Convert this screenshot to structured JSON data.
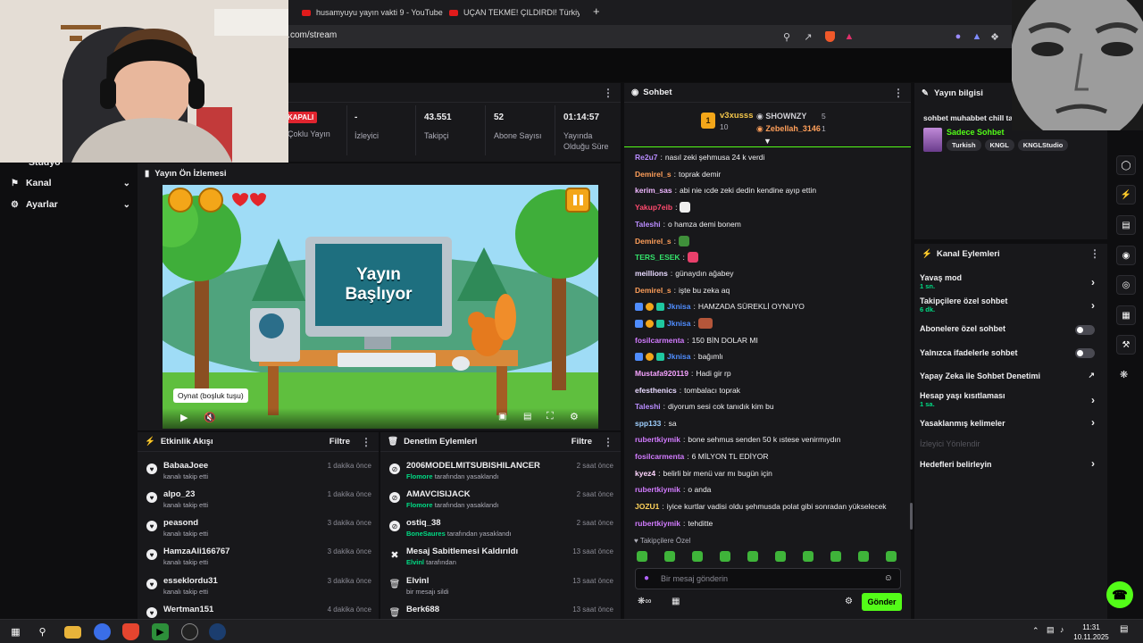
{
  "browser": {
    "tabs": [
      {
        "title": "husamyuyu yayın vakti 9 - YouTube"
      },
      {
        "title": "UÇAN TEKME! ÇILDIRDI! Türkiye'de "
      }
    ],
    "new_tab": "+",
    "url": "ick.com/stream"
  },
  "sidebar": {
    "items": [
      {
        "label": "Stüdyo"
      },
      {
        "label": "Kanal"
      },
      {
        "label": "Ayarlar"
      }
    ]
  },
  "stats": [
    {
      "value": "KAPALI",
      "label": "Çoklu Yayın"
    },
    {
      "value": "-",
      "label": "İzleyici"
    },
    {
      "value": "43.551",
      "label": "Takipçi"
    },
    {
      "value": "52",
      "label": "Abone Sayısı"
    },
    {
      "value": "01:14:57",
      "label": "Yayında Olduğu Süre"
    }
  ],
  "preview": {
    "title": "Yayın Ön İzlemesi",
    "screen_line1": "Yayın",
    "screen_line2": "Başlıyor",
    "tooltip": "Oynat (boşluk tuşu)"
  },
  "activity": {
    "title": "Etkinlik Akışı",
    "filter": "Filtre",
    "items": [
      {
        "name": "BabaaJoee",
        "desc": "kanalı takip etti",
        "time": "1 dakika önce"
      },
      {
        "name": "alpo_23",
        "desc": "kanalı takip etti",
        "time": "1 dakika önce"
      },
      {
        "name": "peasond",
        "desc": "kanalı takip etti",
        "time": "3 dakika önce"
      },
      {
        "name": "HamzaAli166767",
        "desc": "kanalı takip etti",
        "time": "3 dakika önce"
      },
      {
        "name": "esseklordu31",
        "desc": "kanalı takip etti",
        "time": "3 dakika önce"
      },
      {
        "name": "Wertman151",
        "desc": "",
        "time": "4 dakika önce"
      }
    ]
  },
  "moderation": {
    "title": "Denetim Eylemleri",
    "filter": "Filtre",
    "items": [
      {
        "name": "2006MODELMITSUBISHILANCER",
        "actor": "Flomore",
        "desc": "tarafından yasaklandı",
        "time": "2 saat önce"
      },
      {
        "name": "AMAVCISIJACK",
        "actor": "Flomore",
        "desc": "tarafından yasaklandı",
        "time": "2 saat önce"
      },
      {
        "name": "ostiq_38",
        "actor": "BoneSaures",
        "desc": "tarafından yasaklandı",
        "time": "2 saat önce"
      },
      {
        "name": "Mesaj Sabitlemesi Kaldırıldı",
        "actor": "Elvinl",
        "desc": "tarafından",
        "time": "13 saat önce"
      },
      {
        "name": "Elvinl",
        "actor": "",
        "desc": "bir mesajı sildi",
        "time": "13 saat önce"
      },
      {
        "name": "Berk688",
        "actor": "",
        "desc": "",
        "time": "13 saat önce"
      }
    ]
  },
  "chat": {
    "title": "Sohbet",
    "leaders": [
      {
        "rank": "1",
        "name": "v3xusss",
        "count": "10"
      },
      {
        "name": "SHOWNZY",
        "count": "5"
      },
      {
        "name": "Zebellah_3146",
        "count": "1"
      }
    ],
    "messages": [
      {
        "user": "Re2u7",
        "color": "#b98cff",
        "text": "nasıl zeki şehmusa 24 k verdi"
      },
      {
        "user": "Demirel_s",
        "color": "#ff9f5a",
        "text": "toprak demir"
      },
      {
        "user": "kerim_sas",
        "color": "#efb7ff",
        "text": "abi nie ıcde zeki dedin kendine ayıp ettin"
      },
      {
        "user": "Yakup7eib",
        "color": "#ff4a6e",
        "text": ""
      },
      {
        "user": "Taleshi",
        "color": "#b98cff",
        "text": "o hamza demi bonem"
      },
      {
        "user": "Demirel_s",
        "color": "#ff9f5a",
        "text": ""
      },
      {
        "user": "TERS_ESEK",
        "color": "#34e36b",
        "text": ""
      },
      {
        "user": "meillions",
        "color": "#e8d9ff",
        "text": "günaydın ağabey"
      },
      {
        "user": "Demirel_s",
        "color": "#ff9f5a",
        "text": "işte bu zeka aq"
      },
      {
        "user": "Jknisa",
        "color": "#4f8dff",
        "text": "HAMZADA SÜREKLİ OYNUYO"
      },
      {
        "user": "Jknisa",
        "color": "#4f8dff",
        "text": ""
      },
      {
        "user": "fosilcarmenta",
        "color": "#d27bff",
        "text": "150 BİN DOLAR MI"
      },
      {
        "user": "Jknisa",
        "color": "#4f8dff",
        "text": "bağımlı"
      },
      {
        "user": "Mustafa920119",
        "color": "#f6a3ff",
        "text": "Hadi gir rp"
      },
      {
        "user": "efesthenics",
        "color": "#e8d9ff",
        "text": "tombalacı toprak"
      },
      {
        "user": "Taleshi",
        "color": "#b98cff",
        "text": "diyorum sesi cok tanıdık kim bu"
      },
      {
        "user": "spp133",
        "color": "#9fd0ff",
        "text": "sa"
      },
      {
        "user": "rubertkiymik",
        "color": "#d27bff",
        "text": "bone sehmus senden 50 k ıstese venirmıydın"
      },
      {
        "user": "fosilcarmenta",
        "color": "#d27bff",
        "text": "6 MİLYON TL EDİYOR"
      },
      {
        "user": "kyez4",
        "color": "#ffd6ff",
        "text": "belirli bir menü var mı bugün için"
      },
      {
        "user": "rubertkiymik",
        "color": "#d27bff",
        "text": "o anda"
      },
      {
        "user": "JOZU1",
        "color": "#ffd25a",
        "text": "iyice kurtlar vadisi oldu şehmusda polat gibi sonradan yükselecek"
      },
      {
        "user": "rubertkiymik",
        "color": "#d27bff",
        "text": "tehditte"
      }
    ],
    "mode_label": "Takipçilere Özel",
    "input_placeholder": "Bir mesaj gönderin",
    "send_label": "Gönder"
  },
  "stream_info": {
    "title": "Yayın bilgisi",
    "stream_title": "sohbet muhabbet chill ta",
    "category": "Sadece Sohbet",
    "tags": [
      "Turkish",
      "KNGL",
      "KNGLStudio"
    ]
  },
  "channel_actions": {
    "title": "Kanal Eylemleri",
    "items": [
      {
        "label": "Yavaş mod",
        "sub": "1 sn."
      },
      {
        "label": "Takipçilere özel sohbet",
        "sub": "6 dk."
      },
      {
        "label": "Abonelere özel sohbet",
        "sub": ""
      },
      {
        "label": "Yalnızca ifadelerle sohbet",
        "sub": ""
      },
      {
        "label": "Yapay Zeka ile Sohbet Denetimi",
        "sub": ""
      },
      {
        "label": "Hesap yaşı kısıtlaması",
        "sub": "1 sa."
      },
      {
        "label": "Yasaklanmış kelimeler",
        "sub": ""
      },
      {
        "label": "İzleyici Yönlendir",
        "sub": ""
      },
      {
        "label": "Hedefleri belirleyin",
        "sub": ""
      }
    ]
  },
  "taskbar": {
    "time": "11:31",
    "date": "10.11.2025"
  },
  "colors": {
    "accent": "#53fc18",
    "background": "#0e0e10",
    "panel": "#18181b"
  }
}
